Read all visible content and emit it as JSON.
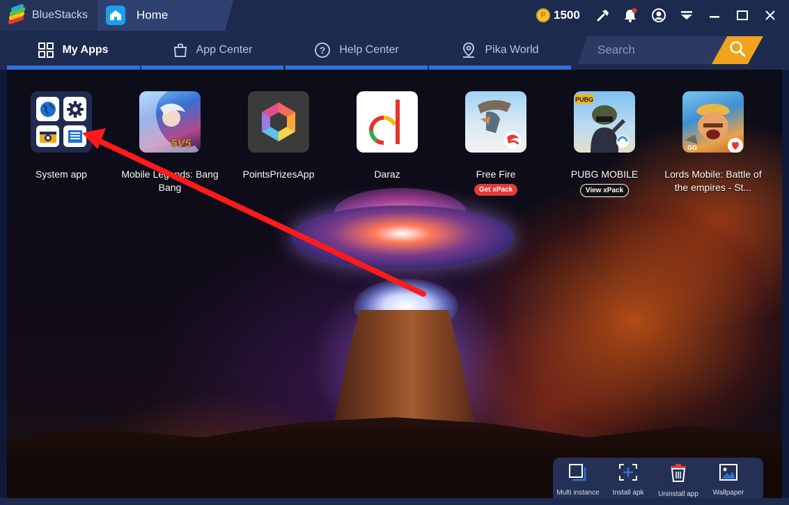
{
  "titlebar": {
    "brand": "BlueStacks",
    "tab_label": "Home",
    "coin_symbol": "P",
    "coin_count": "1500"
  },
  "nav": {
    "tabs": [
      {
        "label": "My Apps",
        "icon": "grid-icon",
        "active": true
      },
      {
        "label": "App Center",
        "icon": "bag-icon",
        "active": false
      },
      {
        "label": "Help Center",
        "icon": "help-icon",
        "active": false
      },
      {
        "label": "Pika World",
        "icon": "location-pin-icon",
        "active": false
      }
    ],
    "search_placeholder": "Search"
  },
  "apps": [
    {
      "label": "System app"
    },
    {
      "label": "Mobile Legends: Bang Bang"
    },
    {
      "label": "PointsPrizesApp"
    },
    {
      "label": "Daraz"
    },
    {
      "label": "Free Fire",
      "badge": "Get xPack"
    },
    {
      "label": "PUBG MOBILE",
      "badge": "View xPack"
    },
    {
      "label": "Lords Mobile: Battle of the empires - St..."
    }
  ],
  "app_art": {
    "ml": "5V5",
    "pubg": "PUBG",
    "daraz": "d",
    "lords": "GG"
  },
  "toolbar": {
    "items": [
      {
        "label": "Multi instance"
      },
      {
        "label": "Install apk"
      },
      {
        "label": "Uninstall app"
      },
      {
        "label": "Wallpaper"
      }
    ]
  },
  "colors": {
    "accent_blue": "#2f72d8",
    "search_orange": "#f1a31b",
    "annotation_red": "#ff1a1a"
  }
}
